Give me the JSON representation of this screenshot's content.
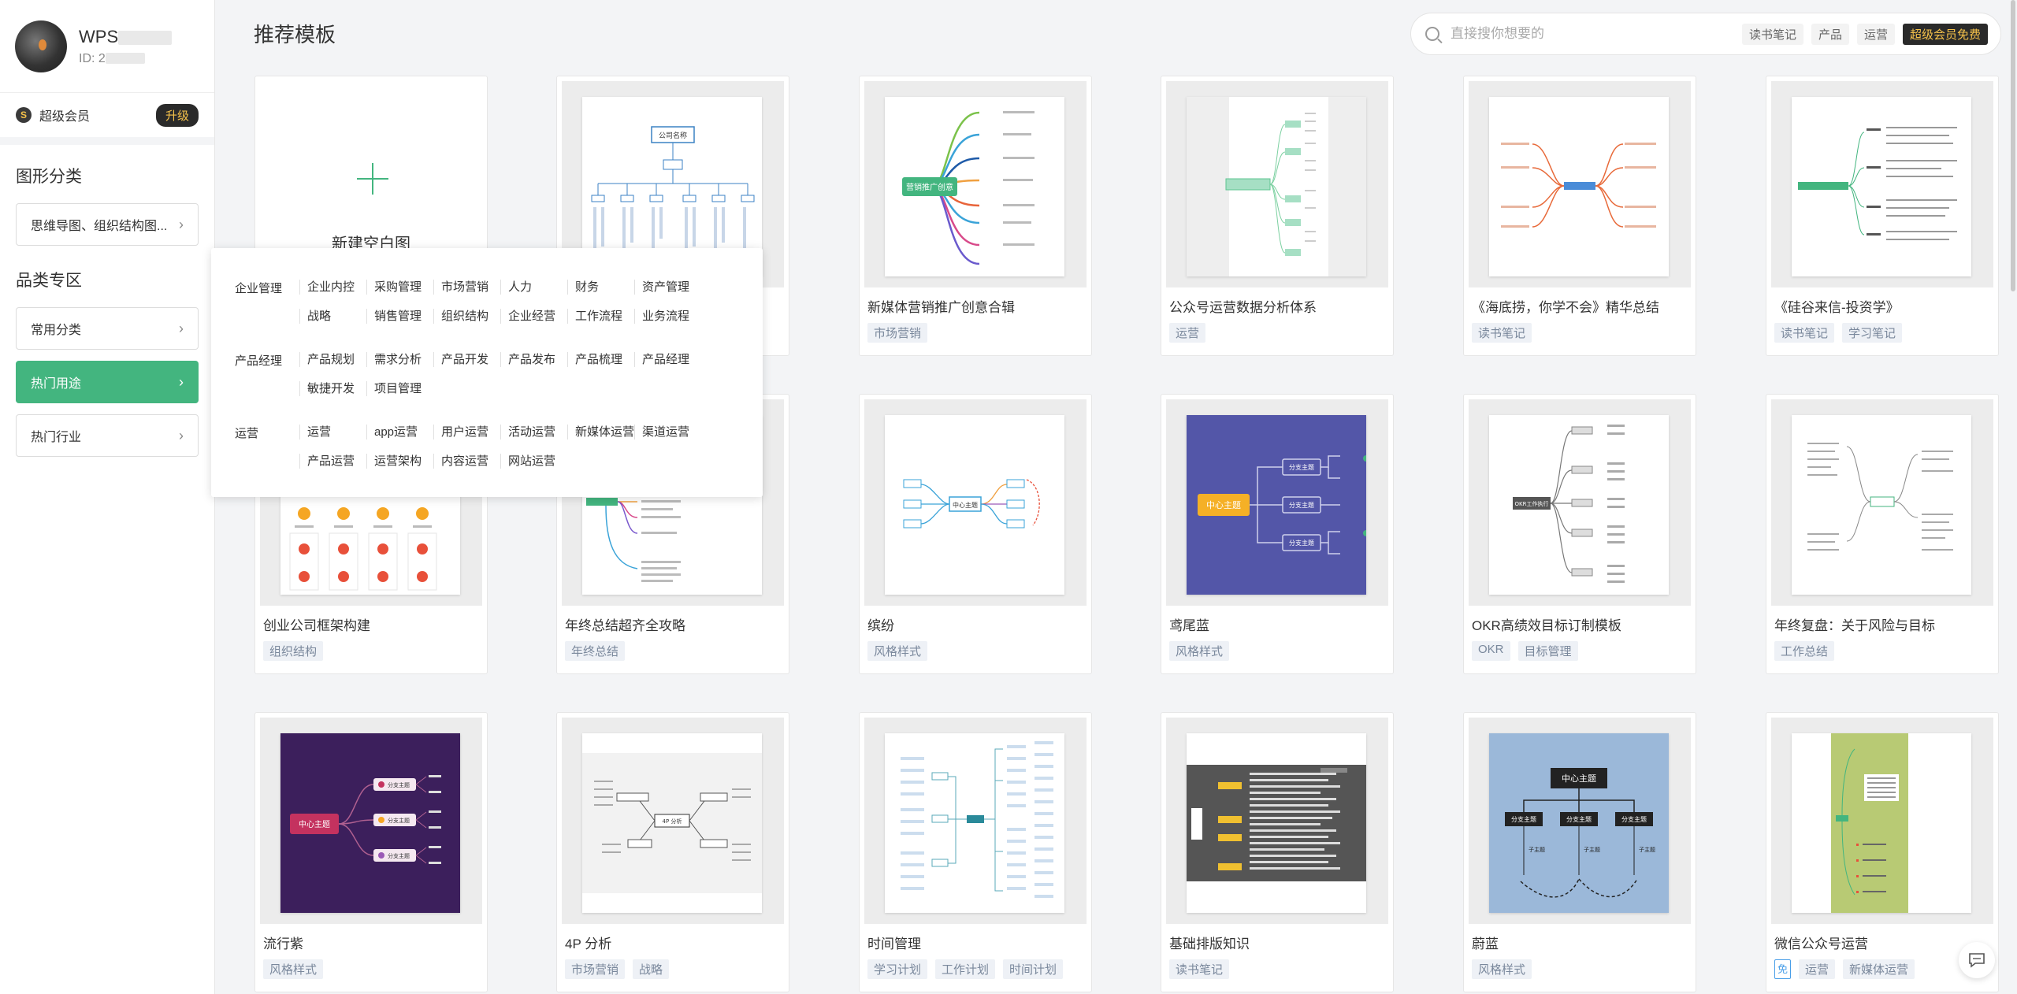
{
  "user": {
    "name": "WPS",
    "id_label": "ID: 2"
  },
  "vip": {
    "label": "超级会员",
    "upgrade": "升级",
    "icon_letter": "S"
  },
  "sidebar": {
    "graph_section": "图形分类",
    "graph_button": "思维导图、组织结构图...",
    "category_section": "品类专区",
    "items": [
      {
        "label": "常用分类"
      },
      {
        "label": "热门用途"
      },
      {
        "label": "热门行业"
      }
    ]
  },
  "page_title": "推荐模板",
  "search": {
    "placeholder": "直接搜你想要的",
    "hints": [
      "读书笔记",
      "产品",
      "运营"
    ],
    "vip_free": "超级会员免费"
  },
  "new_card": {
    "label": "新建空白图"
  },
  "cards": [
    {
      "title": "",
      "tags": []
    },
    {
      "title": "新媒体营销推广创意合辑",
      "tags": [
        "市场营销"
      ]
    },
    {
      "title": "公众号运营数据分析体系",
      "tags": [
        "运营"
      ]
    },
    {
      "title": "《海底捞，你学不会》精华总结",
      "tags": [
        "读书笔记"
      ]
    },
    {
      "title": "《硅谷来信-投资学》",
      "tags": [
        "读书笔记",
        "学习笔记"
      ]
    },
    {
      "title": "创业公司框架构建",
      "tags": [
        "组织结构"
      ]
    },
    {
      "title": "年终总结超齐全攻略",
      "tags": [
        "年终总结"
      ]
    },
    {
      "title": "缤纷",
      "tags": [
        "风格样式"
      ]
    },
    {
      "title": "鸢尾蓝",
      "tags": [
        "风格样式"
      ]
    },
    {
      "title": "OKR高绩效目标订制模板",
      "tags": [
        "OKR",
        "目标管理"
      ]
    },
    {
      "title": "年终复盘：关于风险与目标",
      "tags": [
        "工作总结"
      ]
    },
    {
      "title": "流行紫",
      "tags": [
        "风格样式"
      ]
    },
    {
      "title": "4P 分析",
      "tags": [
        "市场营销",
        "战略"
      ]
    },
    {
      "title": "时间管理",
      "tags": [
        "学习计划",
        "工作计划",
        "时间计划"
      ]
    },
    {
      "title": "基础排版知识",
      "tags": [
        "读书笔记"
      ]
    },
    {
      "title": "蔚蓝",
      "tags": [
        "风格样式"
      ]
    },
    {
      "title": "微信公众号运营",
      "tags": [
        "运营",
        "新媒体运营"
      ],
      "free_badge": "免"
    }
  ],
  "thumb_text": {
    "company": "公司名称",
    "marketing": "营销推广创意",
    "center": "中心主题",
    "branch": "分支主题",
    "okr": "OKR工作执行",
    "fourp": "4P 分析",
    "sub": "子主题"
  },
  "popup": {
    "groups": [
      {
        "head": "企业管理",
        "items": [
          "企业内控",
          "采购管理",
          "市场营销",
          "人力",
          "财务",
          "资产管理",
          "战略",
          "销售管理",
          "组织结构",
          "企业经营",
          "工作流程",
          "业务流程"
        ]
      },
      {
        "head": "产品经理",
        "items": [
          "产品规划",
          "需求分析",
          "产品开发",
          "产品发布",
          "产品梳理",
          "产品经理",
          "敏捷开发",
          "项目管理"
        ]
      },
      {
        "head": "运营",
        "items": [
          "运营",
          "app运营",
          "用户运营",
          "活动运营",
          "新媒体运营",
          "渠道运营",
          "产品运营",
          "运营架构",
          "内容运营",
          "网站运营"
        ]
      }
    ]
  },
  "colors": {
    "accent": "#43b57f",
    "vip_gold": "#f6c24a",
    "iris": "#5356a8",
    "purple": "#3c1f5c",
    "azure": "#9bb8d9",
    "olive": "#b8ca74"
  }
}
